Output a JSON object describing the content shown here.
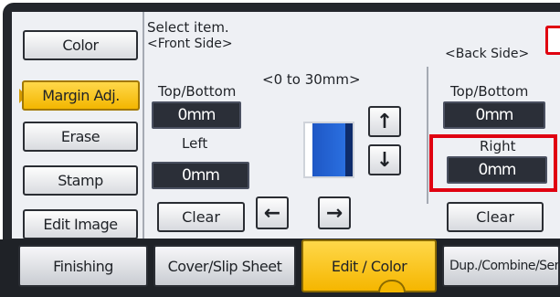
{
  "colors": {
    "accent": "#f5b600",
    "highlight": "#e00010",
    "value_bg": "#2b2f38",
    "doc_blue": "#1e57c5"
  },
  "sidebar": {
    "items": [
      {
        "label": "Color",
        "active": false
      },
      {
        "label": "Margin Adj.",
        "active": true
      },
      {
        "label": "Erase",
        "active": false
      },
      {
        "label": "Stamp",
        "active": false
      },
      {
        "label": "Edit Image",
        "active": false
      }
    ]
  },
  "prompt": "Select item.",
  "front": {
    "heading": "<Front Side>",
    "top_bottom_label": "Top/Bottom",
    "top_bottom_value": "0mm",
    "left_label": "Left",
    "left_value": "0mm",
    "clear_label": "Clear"
  },
  "range_label": "<0 to 30mm>",
  "arrows": {
    "up": "↑",
    "down": "↓",
    "left": "←",
    "right": "→"
  },
  "back": {
    "heading": "<Back Side>",
    "top_bottom_label": "Top/Bottom",
    "top_bottom_value": "0mm",
    "right_label": "Right",
    "right_value": "0mm",
    "clear_label": "Clear"
  },
  "tabs": [
    {
      "label": "Finishing",
      "active": false
    },
    {
      "label": "Cover/Slip Sheet",
      "active": false
    },
    {
      "label": "Edit / Color",
      "active": true
    },
    {
      "label": "Dup./Combine/Seri",
      "active": false
    }
  ]
}
